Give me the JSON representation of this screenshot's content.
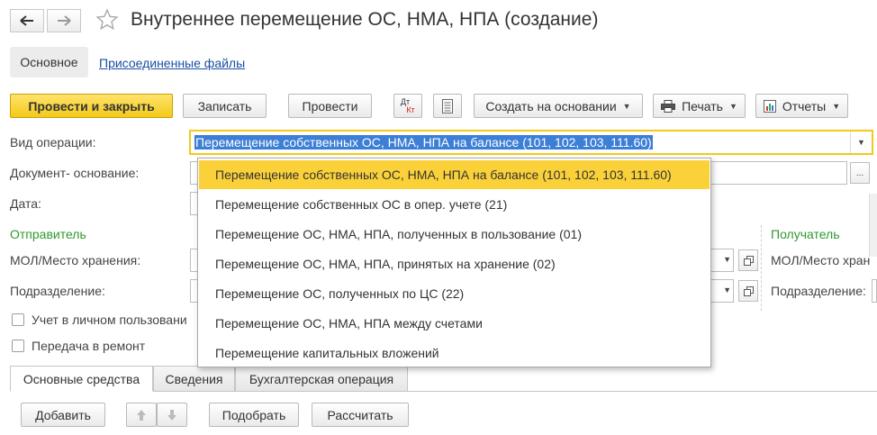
{
  "window": {
    "title": "Внутреннее перемещение ОС, НМА, НПА (создание)"
  },
  "sections": {
    "main_label": "Основное",
    "files_link": "Присоединенные файлы"
  },
  "toolbar": {
    "post_close": "Провести и закрыть",
    "save": "Записать",
    "post": "Провести",
    "dtkt_top": "Дт",
    "dtkt_bottom": "Кт",
    "create_based": "Создать на основании",
    "print": "Печать",
    "reports": "Отчеты"
  },
  "form": {
    "operation_label": "Вид операции:",
    "operation_value": "Перемещение собственных ОС, НМА, НПА на балансе (101, 102, 103, 111.60)",
    "basis_label": "Документ- основание:",
    "date_label": "Дата:",
    "sender_header": "Отправитель",
    "receiver_header": "Получатель",
    "mol_label": "МОЛ/Место хранения:",
    "mol_label_receiver": "МОЛ/Место хран",
    "dept_label": "Подразделение:",
    "dept_label_receiver": "Подразделение:",
    "personal_use": "Учет в личном пользовани",
    "repair": "Передача в ремонт",
    "ellipsis": "..."
  },
  "dropdown": {
    "options": [
      "Перемещение собственных ОС, НМА, НПА на балансе (101, 102, 103, 111.60)",
      "Перемещение собственных ОС в опер. учете (21)",
      "Перемещение ОС, НМА, НПА, полученных в пользование (01)",
      "Перемещение ОС, НМА, НПА, принятых на хранение (02)",
      "Перемещение ОС, полученных по ЦС (22)",
      "Перемещение ОС, НМА, НПА между счетами",
      "Перемещение капитальных вложений"
    ]
  },
  "tabs": {
    "fixed_assets": "Основные средства",
    "info": "Сведения",
    "accounting": "Бухгалтерская операция"
  },
  "table_toolbar": {
    "add": "Добавить",
    "pick": "Подобрать",
    "calculate": "Рассчитать"
  },
  "colors": {
    "accent_yellow": "#fbd13a",
    "green_header": "#2e9a2e",
    "link_blue": "#1a4fa3"
  }
}
